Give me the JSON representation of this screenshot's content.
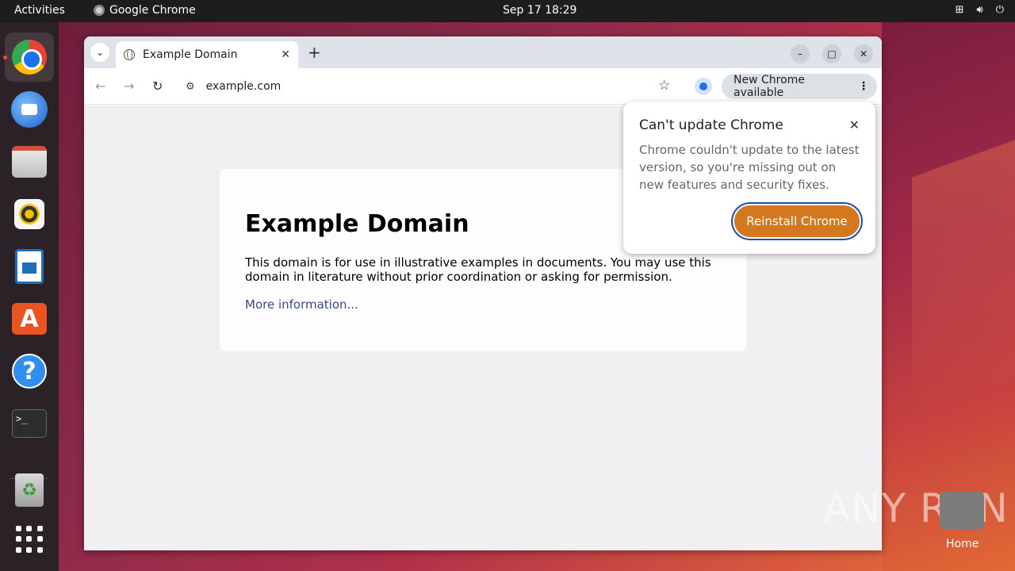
{
  "topbar": {
    "activities": "Activities",
    "app_name": "Google Chrome",
    "clock": "Sep 17  18:29",
    "tray_icons": [
      "network-icon",
      "volume-icon",
      "power-icon"
    ]
  },
  "dock": {
    "items": [
      "chrome",
      "thunderbird",
      "files",
      "rhythmbox",
      "libreoffice-writer",
      "app-center",
      "help",
      "terminal",
      "trash",
      "show-apps"
    ]
  },
  "browser": {
    "tab_title": "Example Domain",
    "url": "example.com",
    "update_chip": "New Chrome available"
  },
  "page": {
    "heading": "Example Domain",
    "paragraph": "This domain is for use in illustrative examples in documents. You may use this domain in literature without prior coordination or asking for permission.",
    "link": "More information..."
  },
  "popup": {
    "title": "Can't update Chrome",
    "body": "Chrome couldn't update to the latest version, so you're missing out on new features and security fixes.",
    "button": "Reinstall Chrome"
  },
  "desktop": {
    "home_label": "Home",
    "watermark": "ANY RUN"
  },
  "colors": {
    "accent": "#d2781f",
    "link": "#38488f",
    "ubuntu_orange": "#e95420"
  }
}
